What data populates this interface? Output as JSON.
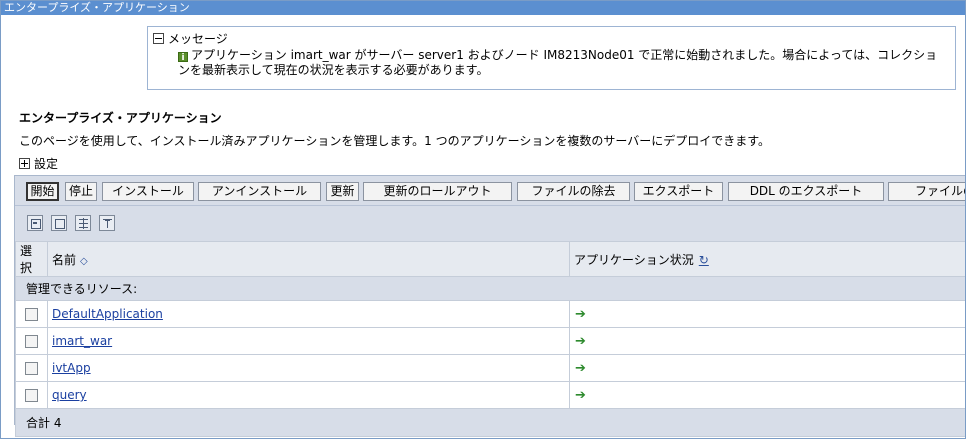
{
  "window": {
    "title": "エンタープライズ・アプリケーション"
  },
  "message": {
    "header": "メッセージ",
    "text": "アプリケーション imart_war がサーバー server1 およびノード IM8213Node01 で正常に始動されました。場合によっては、コレクションを最新表示して現在の状況を表示する必要があります。"
  },
  "page": {
    "title": "エンタープライズ・アプリケーション",
    "description": "このページを使用して、インストール済みアプリケーションを管理します。1 つのアプリケーションを複数のサーバーにデプロイできます。",
    "settings": "設定"
  },
  "buttons": {
    "start": "開始",
    "stop": "停止",
    "install": "インストール",
    "uninstall": "アンインストール",
    "update": "更新",
    "rollout": "更新のロールアウト",
    "remove_file": "ファイルの除去",
    "export": "エクスポート",
    "export_ddl": "DDL のエクスポート",
    "file_transfer": "ファイルの"
  },
  "table": {
    "columns": {
      "select": "選択",
      "name": "名前",
      "status": "アプリケーション状況"
    },
    "group_label": "管理できるリソース:",
    "rows": [
      {
        "name": "DefaultApplication",
        "status_icon": "started-arrow-icon"
      },
      {
        "name": "imart_war",
        "status_icon": "started-arrow-icon"
      },
      {
        "name": "ivtApp",
        "status_icon": "started-arrow-icon"
      },
      {
        "name": "query",
        "status_icon": "started-arrow-icon"
      }
    ],
    "total": "合計 4"
  },
  "colors": {
    "titlebar": "#5b8fd0",
    "panel": "#d7dde8",
    "link": "#1a3fa0",
    "status_arrow": "#2d8a2d"
  }
}
